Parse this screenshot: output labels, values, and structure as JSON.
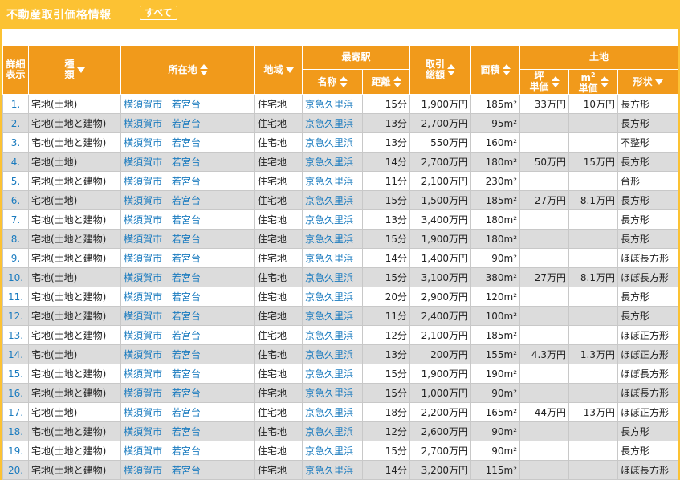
{
  "header": {
    "title": "不動産取引価格情報",
    "all_button": "すべて"
  },
  "columns": {
    "detail_1": "詳細",
    "detail_2": "表示",
    "type_1": "種",
    "type_2": "類",
    "location": "所在地",
    "zone": "地域",
    "station_group": "最寄駅",
    "station_name": "名称",
    "station_dist": "距離",
    "price_1": "取引",
    "price_2": "総額",
    "area": "面積",
    "land_group": "土地",
    "tsubo_1": "坪",
    "tsubo_2": "単価",
    "m2_1": "m",
    "m2_sup": "2",
    "m2_2": "単価",
    "shape": "形状"
  },
  "rows": [
    {
      "no": "1.",
      "type": "宅地(土地)",
      "city": "横須賀市",
      "area_name": "若宮台",
      "zone": "住宅地",
      "station": "京急久里浜",
      "dist": "15分",
      "price": "1,900万円",
      "area": "185m²",
      "tsubo": "33万円",
      "m2": "10万円",
      "shape": "長方形"
    },
    {
      "no": "2.",
      "type": "宅地(土地と建物)",
      "city": "横須賀市",
      "area_name": "若宮台",
      "zone": "住宅地",
      "station": "京急久里浜",
      "dist": "13分",
      "price": "2,700万円",
      "area": "95m²",
      "tsubo": "",
      "m2": "",
      "shape": "長方形"
    },
    {
      "no": "3.",
      "type": "宅地(土地と建物)",
      "city": "横須賀市",
      "area_name": "若宮台",
      "zone": "住宅地",
      "station": "京急久里浜",
      "dist": "13分",
      "price": "550万円",
      "area": "160m²",
      "tsubo": "",
      "m2": "",
      "shape": "不整形"
    },
    {
      "no": "4.",
      "type": "宅地(土地)",
      "city": "横須賀市",
      "area_name": "若宮台",
      "zone": "住宅地",
      "station": "京急久里浜",
      "dist": "14分",
      "price": "2,700万円",
      "area": "180m²",
      "tsubo": "50万円",
      "m2": "15万円",
      "shape": "長方形"
    },
    {
      "no": "5.",
      "type": "宅地(土地と建物)",
      "city": "横須賀市",
      "area_name": "若宮台",
      "zone": "住宅地",
      "station": "京急久里浜",
      "dist": "11分",
      "price": "2,100万円",
      "area": "230m²",
      "tsubo": "",
      "m2": "",
      "shape": "台形"
    },
    {
      "no": "6.",
      "type": "宅地(土地)",
      "city": "横須賀市",
      "area_name": "若宮台",
      "zone": "住宅地",
      "station": "京急久里浜",
      "dist": "15分",
      "price": "1,500万円",
      "area": "185m²",
      "tsubo": "27万円",
      "m2": "8.1万円",
      "shape": "長方形"
    },
    {
      "no": "7.",
      "type": "宅地(土地と建物)",
      "city": "横須賀市",
      "area_name": "若宮台",
      "zone": "住宅地",
      "station": "京急久里浜",
      "dist": "13分",
      "price": "3,400万円",
      "area": "180m²",
      "tsubo": "",
      "m2": "",
      "shape": "長方形"
    },
    {
      "no": "8.",
      "type": "宅地(土地と建物)",
      "city": "横須賀市",
      "area_name": "若宮台",
      "zone": "住宅地",
      "station": "京急久里浜",
      "dist": "15分",
      "price": "1,900万円",
      "area": "180m²",
      "tsubo": "",
      "m2": "",
      "shape": "長方形"
    },
    {
      "no": "9.",
      "type": "宅地(土地と建物)",
      "city": "横須賀市",
      "area_name": "若宮台",
      "zone": "住宅地",
      "station": "京急久里浜",
      "dist": "14分",
      "price": "1,400万円",
      "area": "90m²",
      "tsubo": "",
      "m2": "",
      "shape": "ほぼ長方形"
    },
    {
      "no": "10.",
      "type": "宅地(土地)",
      "city": "横須賀市",
      "area_name": "若宮台",
      "zone": "住宅地",
      "station": "京急久里浜",
      "dist": "15分",
      "price": "3,100万円",
      "area": "380m²",
      "tsubo": "27万円",
      "m2": "8.1万円",
      "shape": "ほぼ長方形"
    },
    {
      "no": "11.",
      "type": "宅地(土地と建物)",
      "city": "横須賀市",
      "area_name": "若宮台",
      "zone": "住宅地",
      "station": "京急久里浜",
      "dist": "20分",
      "price": "2,900万円",
      "area": "120m²",
      "tsubo": "",
      "m2": "",
      "shape": "長方形"
    },
    {
      "no": "12.",
      "type": "宅地(土地と建物)",
      "city": "横須賀市",
      "area_name": "若宮台",
      "zone": "住宅地",
      "station": "京急久里浜",
      "dist": "11分",
      "price": "2,400万円",
      "area": "100m²",
      "tsubo": "",
      "m2": "",
      "shape": "長方形"
    },
    {
      "no": "13.",
      "type": "宅地(土地と建物)",
      "city": "横須賀市",
      "area_name": "若宮台",
      "zone": "住宅地",
      "station": "京急久里浜",
      "dist": "12分",
      "price": "2,100万円",
      "area": "185m²",
      "tsubo": "",
      "m2": "",
      "shape": "ほぼ正方形"
    },
    {
      "no": "14.",
      "type": "宅地(土地)",
      "city": "横須賀市",
      "area_name": "若宮台",
      "zone": "住宅地",
      "station": "京急久里浜",
      "dist": "13分",
      "price": "200万円",
      "area": "155m²",
      "tsubo": "4.3万円",
      "m2": "1.3万円",
      "shape": "ほぼ正方形"
    },
    {
      "no": "15.",
      "type": "宅地(土地と建物)",
      "city": "横須賀市",
      "area_name": "若宮台",
      "zone": "住宅地",
      "station": "京急久里浜",
      "dist": "15分",
      "price": "1,900万円",
      "area": "190m²",
      "tsubo": "",
      "m2": "",
      "shape": "ほぼ長方形"
    },
    {
      "no": "16.",
      "type": "宅地(土地と建物)",
      "city": "横須賀市",
      "area_name": "若宮台",
      "zone": "住宅地",
      "station": "京急久里浜",
      "dist": "15分",
      "price": "1,000万円",
      "area": "90m²",
      "tsubo": "",
      "m2": "",
      "shape": "ほぼ長方形"
    },
    {
      "no": "17.",
      "type": "宅地(土地)",
      "city": "横須賀市",
      "area_name": "若宮台",
      "zone": "住宅地",
      "station": "京急久里浜",
      "dist": "18分",
      "price": "2,200万円",
      "area": "165m²",
      "tsubo": "44万円",
      "m2": "13万円",
      "shape": "ほぼ正方形"
    },
    {
      "no": "18.",
      "type": "宅地(土地と建物)",
      "city": "横須賀市",
      "area_name": "若宮台",
      "zone": "住宅地",
      "station": "京急久里浜",
      "dist": "12分",
      "price": "2,600万円",
      "area": "90m²",
      "tsubo": "",
      "m2": "",
      "shape": "長方形"
    },
    {
      "no": "19.",
      "type": "宅地(土地と建物)",
      "city": "横須賀市",
      "area_name": "若宮台",
      "zone": "住宅地",
      "station": "京急久里浜",
      "dist": "15分",
      "price": "2,700万円",
      "area": "90m²",
      "tsubo": "",
      "m2": "",
      "shape": "長方形"
    },
    {
      "no": "20.",
      "type": "宅地(土地と建物)",
      "city": "横須賀市",
      "area_name": "若宮台",
      "zone": "住宅地",
      "station": "京急久里浜",
      "dist": "14分",
      "price": "3,200万円",
      "area": "115m²",
      "tsubo": "",
      "m2": "",
      "shape": "ほぼ長方形"
    }
  ],
  "colors": {
    "header_bar": "#fcc233",
    "table_header": "#f19a1b",
    "link": "#1a7bbf",
    "row_alt": "#dcdcdc"
  },
  "icons": {
    "sort_both": "sort-updown-icon",
    "sort_down": "sort-down-icon"
  }
}
